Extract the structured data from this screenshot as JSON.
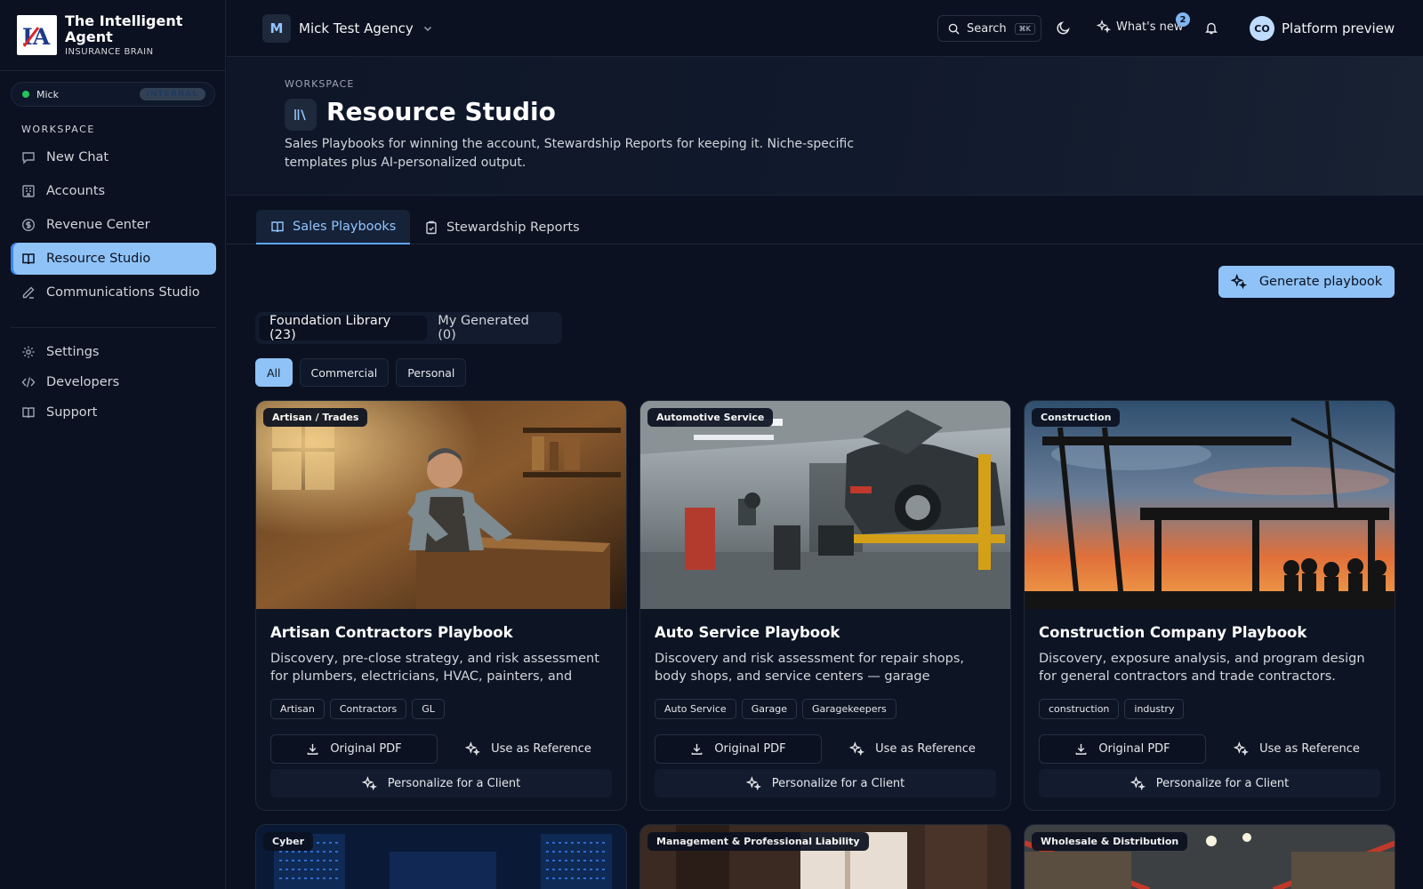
{
  "app": {
    "brand_title": "The Intelligent Agent",
    "brand_subtitle": "INSURANCE BRAIN",
    "logo_text": "IA"
  },
  "user": {
    "name": "Mick",
    "tag": "INTERNAL"
  },
  "sidebar": {
    "section_label": "WORKSPACE",
    "items": [
      {
        "label": "New Chat",
        "icon": "chat-icon"
      },
      {
        "label": "Accounts",
        "icon": "building-icon"
      },
      {
        "label": "Revenue Center",
        "icon": "dollar-icon"
      },
      {
        "label": "Resource Studio",
        "icon": "book-icon",
        "active": true
      },
      {
        "label": "Communications Studio",
        "icon": "pen-icon"
      }
    ],
    "bottom_items": [
      {
        "label": "Settings",
        "icon": "gear-icon"
      },
      {
        "label": "Developers",
        "icon": "code-icon"
      },
      {
        "label": "Support",
        "icon": "book-icon"
      }
    ]
  },
  "topbar": {
    "agency_initial": "M",
    "agency_name": "Mick Test Agency",
    "search_label": "Search",
    "search_shortcut": "⌘K",
    "whats_new_label": "What's new",
    "whats_new_count": "2",
    "profile_initials": "CO",
    "profile_name": "Platform preview"
  },
  "hero": {
    "kicker": "WORKSPACE",
    "title": "Resource Studio",
    "description": "Sales Playbooks for winning the account, Stewardship Reports for keeping it. Niche-specific templates plus AI-personalized output."
  },
  "tabs": [
    {
      "label": "Sales Playbooks",
      "active": true
    },
    {
      "label": "Stewardship Reports",
      "active": false
    }
  ],
  "generate_button": "Generate playbook",
  "library_toggle": [
    {
      "label": "Foundation Library (23)",
      "active": true
    },
    {
      "label": "My Generated (0)",
      "active": false
    }
  ],
  "filters": [
    {
      "label": "All",
      "active": true
    },
    {
      "label": "Commercial",
      "active": false
    },
    {
      "label": "Personal",
      "active": false
    }
  ],
  "card_actions": {
    "pdf": "Original PDF",
    "reference": "Use as Reference",
    "personalize": "Personalize for a Client"
  },
  "cards": [
    {
      "tag": "Artisan / Trades",
      "title": "Artisan Contractors Playbook",
      "description": "Discovery, pre-close strategy, and risk assessment for plumbers, electricians, HVAC, painters, and other…",
      "pills": [
        "Artisan",
        "Contractors",
        "GL"
      ]
    },
    {
      "tag": "Automotive Service",
      "title": "Auto Service Playbook",
      "description": "Discovery and risk assessment for repair shops, body shops, and service centers — garage liability,…",
      "pills": [
        "Auto Service",
        "Garage",
        "Garagekeepers"
      ]
    },
    {
      "tag": "Construction",
      "title": "Construction Company Playbook",
      "description": "Discovery, exposure analysis, and program design for general contractors and trade contractors.",
      "pills": [
        "construction",
        "industry"
      ]
    },
    {
      "tag": "Cyber"
    },
    {
      "tag": "Management & Professional Liability"
    },
    {
      "tag": "Wholesale & Distribution"
    }
  ]
}
